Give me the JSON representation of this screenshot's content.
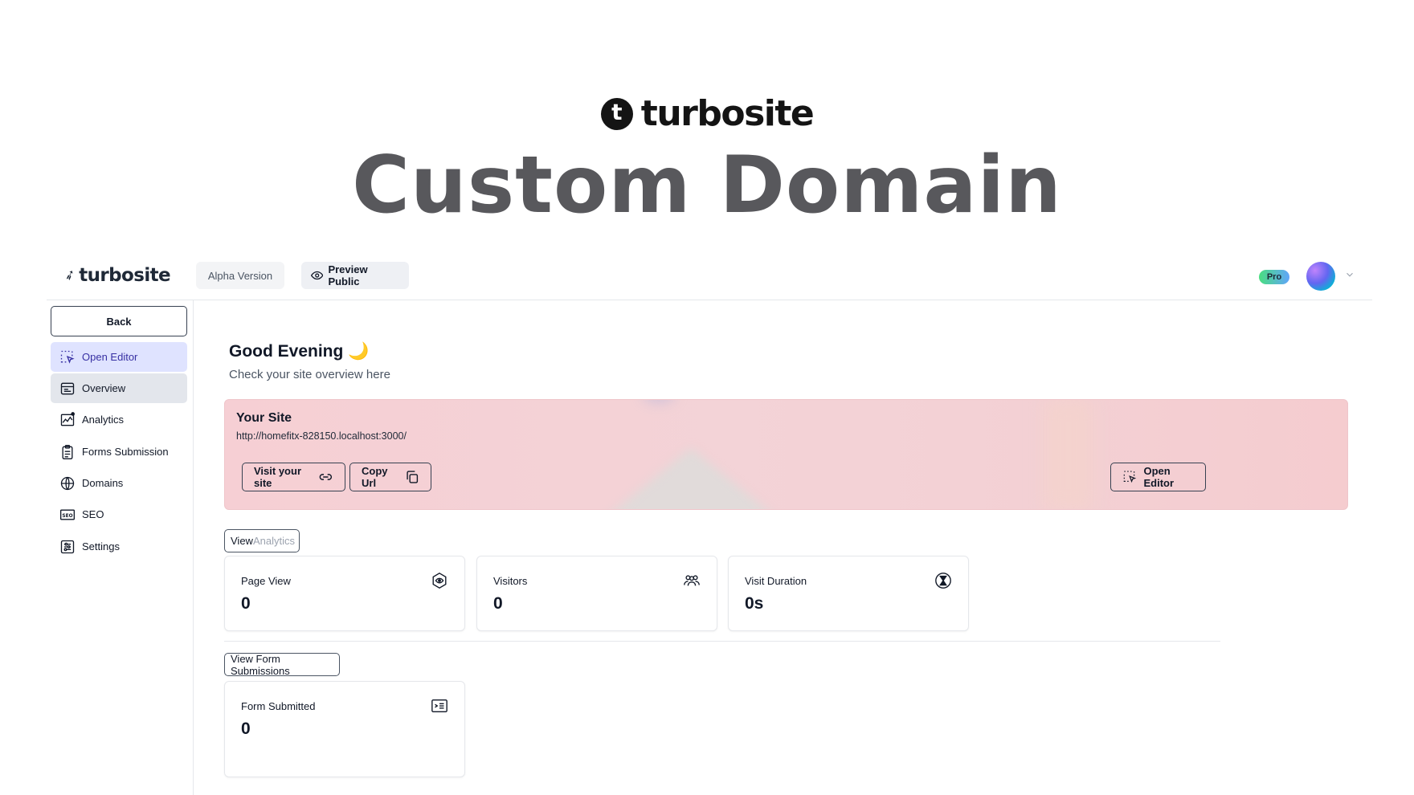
{
  "hero": {
    "brand_letter": "t",
    "brand_name": "turbosite",
    "title": "Custom Domain"
  },
  "header": {
    "logo_text": "turbosite",
    "alpha_label": "Alpha Version",
    "preview_label": "Preview Public",
    "plan_badge": "Pro"
  },
  "sidebar": {
    "back_label": "Back",
    "items": [
      {
        "label": "Open Editor",
        "icon": "cursor-select-icon"
      },
      {
        "label": "Overview",
        "icon": "layout-icon"
      },
      {
        "label": "Analytics",
        "icon": "chart-icon"
      },
      {
        "label": "Forms Submission",
        "icon": "clipboard-icon"
      },
      {
        "label": "Domains",
        "icon": "globe-icon"
      },
      {
        "label": "SEO",
        "icon": "seo-icon"
      },
      {
        "label": "Settings",
        "icon": "sliders-icon"
      }
    ]
  },
  "main": {
    "greeting": "Good Evening 🌙",
    "subtitle": "Check your site overview here",
    "site_card": {
      "title": "Your Site",
      "url": "http://homefitx-828150.localhost:3000/",
      "visit_label": "Visit your site",
      "copy_label": "Copy Url",
      "open_editor_label": "Open Editor"
    },
    "view_analytics_prefix": "View ",
    "view_analytics_suffix": "Analytics",
    "stats": [
      {
        "label": "Page View",
        "value": "0",
        "icon": "hexagon-eye-icon"
      },
      {
        "label": "Visitors",
        "value": "0",
        "icon": "users-icon"
      },
      {
        "label": "Visit Duration",
        "value": "0s",
        "icon": "hourglass-icon"
      }
    ],
    "view_forms_label": "View Form Submissions",
    "forms_stat": {
      "label": "Form Submitted",
      "value": "0",
      "icon": "form-icon"
    }
  }
}
